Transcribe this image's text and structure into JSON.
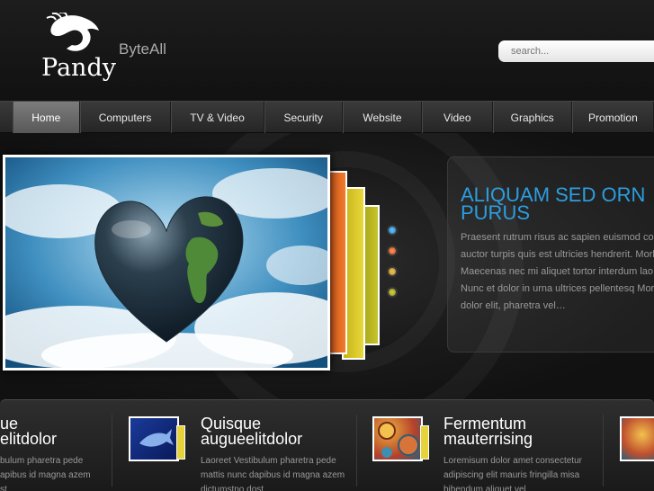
{
  "brand": {
    "name": "Pandy",
    "tagline": "ByteAll"
  },
  "search": {
    "placeholder": "search..."
  },
  "nav": {
    "items": [
      {
        "label": "Home"
      },
      {
        "label": "Computers"
      },
      {
        "label": "TV & Video"
      },
      {
        "label": "Security"
      },
      {
        "label": "Website"
      },
      {
        "label": "Video"
      },
      {
        "label": "Graphics"
      },
      {
        "label": "Promotion"
      }
    ],
    "active_index": 0
  },
  "slider": {
    "title_line1": "Aliquam sed orn",
    "title_line2": "Purus",
    "body": "Praesent rutrum risus ac sapien euismod co auctor turpis quis est ultricies hendrerit. Morb Maecenas nec mi aliquet tortor interdum lao leo. Nunc et dolor in urna ultrices pellentesq Morbi dolor elit, pharetra vel…",
    "dot_colors": [
      "#2a9ee0",
      "#e55a1e",
      "#c7a02a",
      "#9aa020"
    ]
  },
  "features": [
    {
      "title_line1": "ue",
      "title_line2": "elitdolor",
      "body_lines": [
        "bulum pharetra pede",
        "apibus id magna azem",
        "st"
      ]
    },
    {
      "title_line1": "Quisque",
      "title_line2": "augueelitdolor",
      "body_lines": [
        "Laoreet Vestibulum pharetra pede",
        "mattis nunc dapibus id magna azem",
        "dictumstno dost"
      ]
    },
    {
      "title_line1": "Fermentum",
      "title_line2": "mauterrising",
      "body_lines": [
        "Loremisum dolor amet consectetur",
        "adipiscing elit mauris fringilla misa",
        "bibendum aliquet vel"
      ]
    }
  ],
  "colors": {
    "accent_blue": "#2c9ee0",
    "stack_orange": "#e0661c",
    "stack_yellow": "#cfc01f",
    "stack_olive": "#a7a61c"
  }
}
